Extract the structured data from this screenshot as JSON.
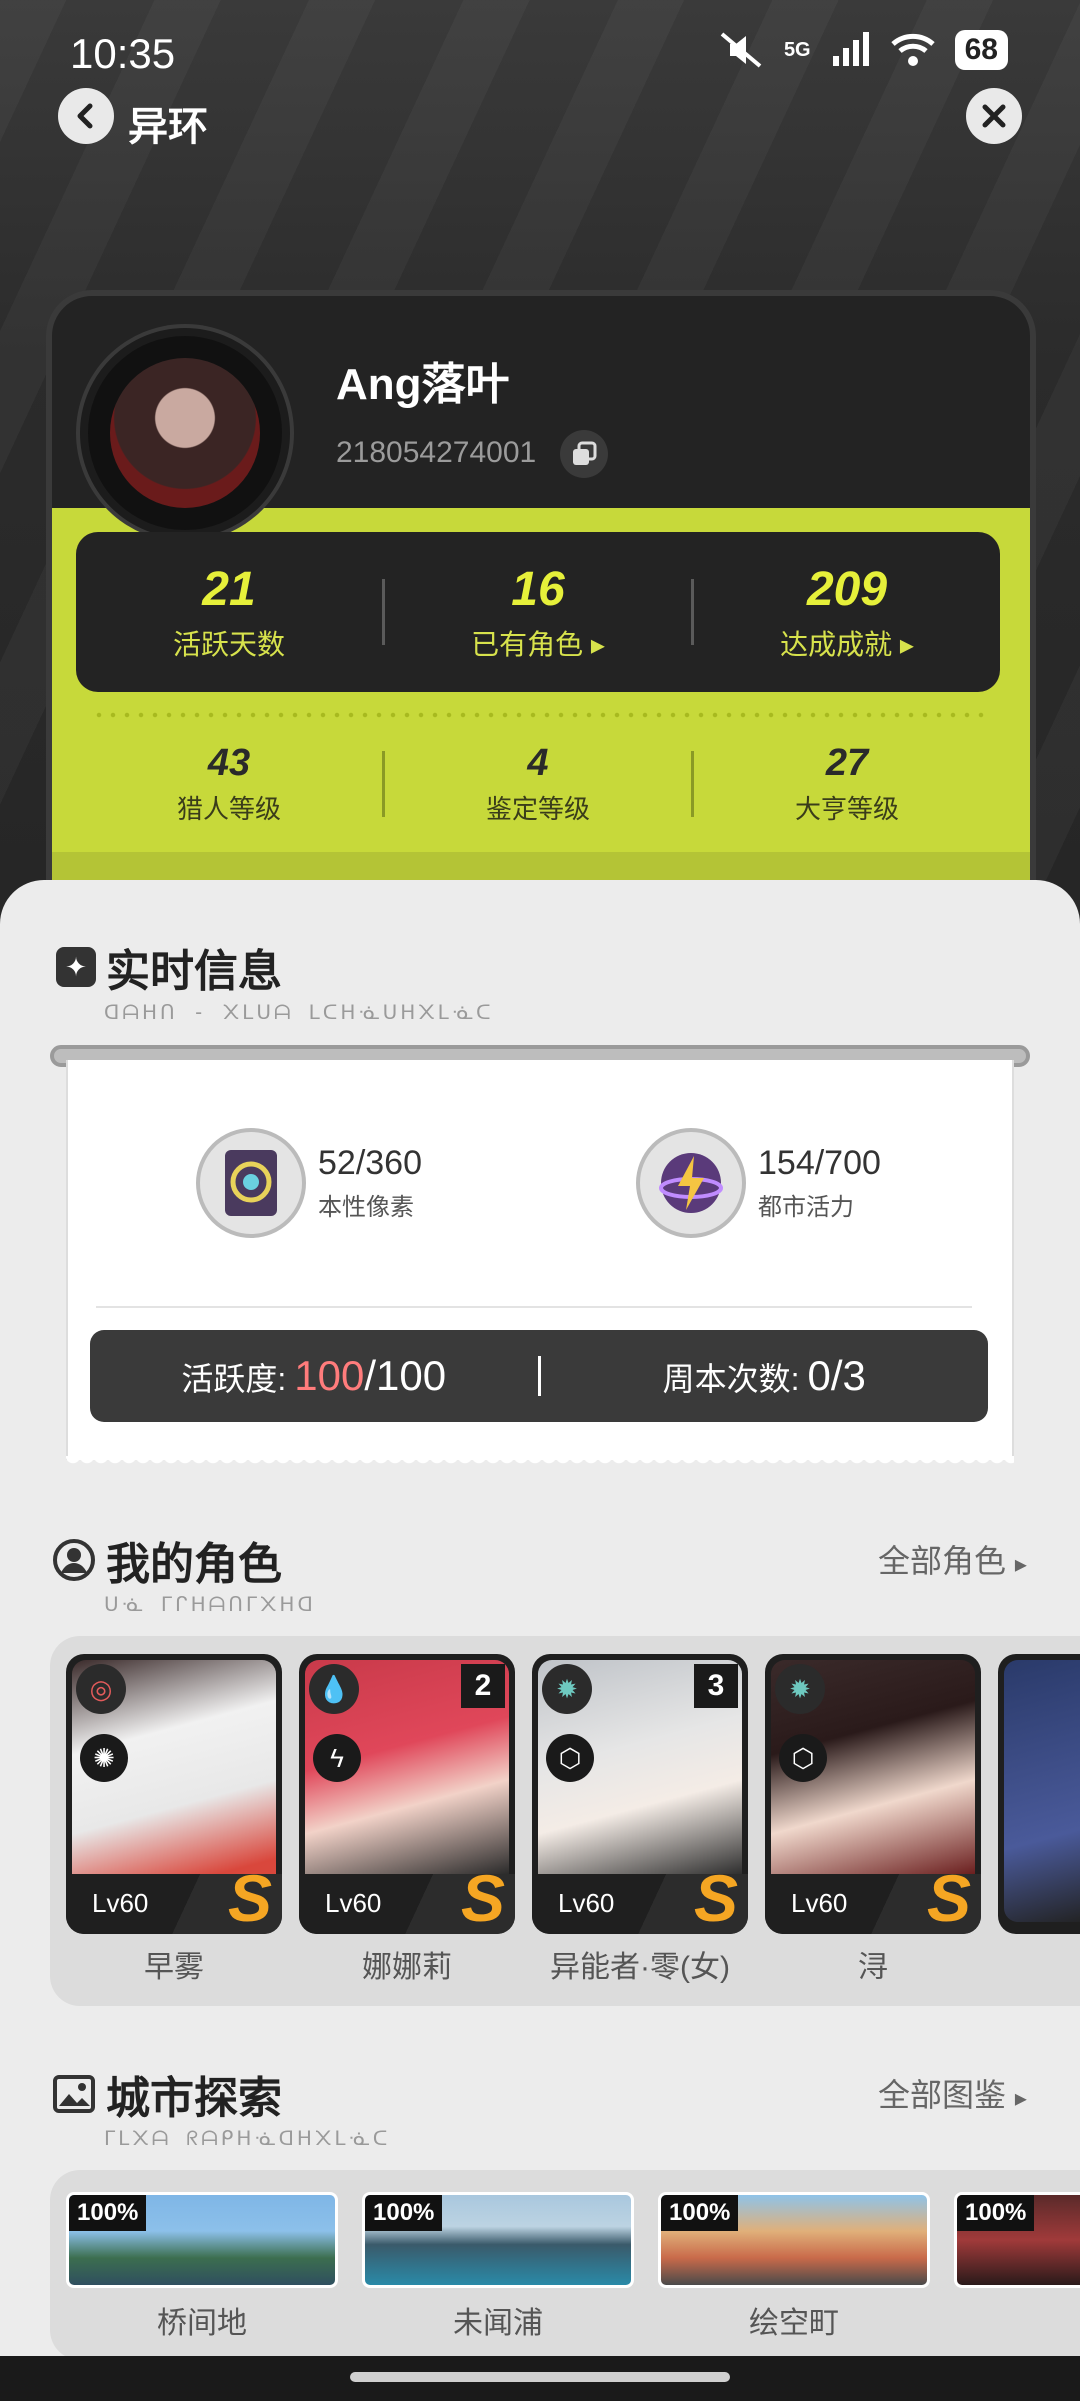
{
  "status_bar": {
    "time": "10:35",
    "network": "5G",
    "battery": "68"
  },
  "nav": {
    "title": "异环"
  },
  "profile": {
    "name": "Ang落叶",
    "uid": "218054274001",
    "top_stats": [
      {
        "value": "21",
        "label": "活跃天数"
      },
      {
        "value": "16",
        "label": "已有角色"
      },
      {
        "value": "209",
        "label": "达成成就"
      }
    ],
    "bottom_stats": [
      {
        "value": "43",
        "label": "猎人等级"
      },
      {
        "value": "4",
        "label": "鉴定等级"
      },
      {
        "value": "27",
        "label": "大亨等级"
      }
    ]
  },
  "realtime": {
    "title": "实时信息",
    "subtitle": "ᗡᗩᕼᑎ - ᙭ᒪᑌᗩ ᒪᑕᕼᓍᑌᕼ᙭ᒪᓍᑕ",
    "resources": [
      {
        "icon": "pixel-card-icon",
        "value": "52/360",
        "label": "本性像素"
      },
      {
        "icon": "lightning-orb-icon",
        "value": "154/700",
        "label": "都市活力"
      }
    ],
    "activity_label": "活跃度:",
    "activity_current": "100",
    "activity_max": "/100",
    "weekly_label": "周本次数:",
    "weekly_value": "0/3"
  },
  "characters": {
    "title": "我的角色",
    "subtitle": "ᑌᓍ ᒥᒋᕼᗩᑎᒥ᙭ᕼᗡ",
    "more": "全部角色",
    "items": [
      {
        "name": "早雾",
        "level": "Lv60",
        "rank": "",
        "element": "target-icon",
        "type": "spiral-icon",
        "accent": "#e35b5b"
      },
      {
        "name": "娜娜莉",
        "level": "Lv60",
        "rank": "2",
        "element": "droplet-icon",
        "type": "bolt-icon",
        "accent": "#38b48a"
      },
      {
        "name": "异能者·零(女)",
        "level": "Lv60",
        "rank": "3",
        "element": "sun-icon",
        "type": "cube-icon",
        "accent": "#6ec9c0"
      },
      {
        "name": "浔",
        "level": "Lv60",
        "rank": "",
        "element": "sun-icon",
        "type": "cube-icon",
        "accent": "#6ec9c0"
      }
    ]
  },
  "city": {
    "title": "城市探索",
    "subtitle": "ᒥᒪ᙭ᗩ ᖇᗩᑭᕼᓍᗡᕼ᙭ᒪᓍᑕ",
    "more": "全部图鉴",
    "items": [
      {
        "name": "桥间地",
        "progress": "100%"
      },
      {
        "name": "未闻浦",
        "progress": "100%"
      },
      {
        "name": "绘空町",
        "progress": "100%"
      },
      {
        "name": "",
        "progress": "100%"
      }
    ]
  }
}
